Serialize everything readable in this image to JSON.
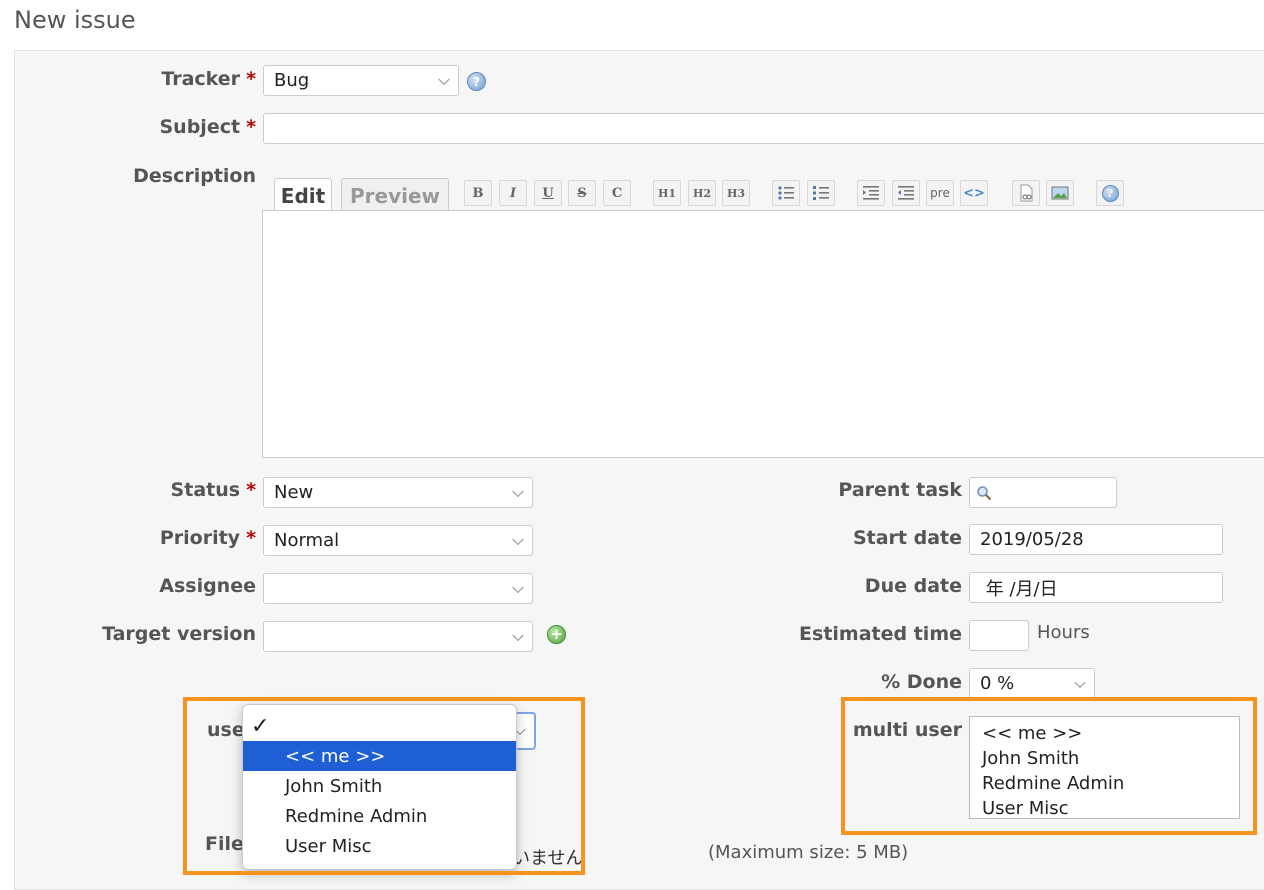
{
  "page": {
    "title": "New issue"
  },
  "tracker": {
    "label": "Tracker",
    "required_mark": "*",
    "value": "Bug"
  },
  "subject": {
    "label": "Subject",
    "required_mark": "*",
    "value": ""
  },
  "description": {
    "label": "Description",
    "tabs": [
      {
        "label": "Edit"
      },
      {
        "label": "Preview"
      }
    ],
    "toolbar": {
      "bold": "B",
      "italic": "I",
      "underline": "U",
      "strike": "S",
      "code": "C",
      "h1": "H1",
      "h2": "H2",
      "h3": "H3",
      "pre": "pre",
      "inline_code": "<>"
    }
  },
  "status": {
    "label": "Status",
    "required_mark": "*",
    "value": "New"
  },
  "priority": {
    "label": "Priority",
    "required_mark": "*",
    "value": "Normal"
  },
  "assignee": {
    "label": "Assignee",
    "value": ""
  },
  "target_version": {
    "label": "Target version",
    "value": ""
  },
  "parent_task": {
    "label": "Parent task",
    "value": ""
  },
  "start_date": {
    "label": "Start date",
    "value": "2019/05/28"
  },
  "due_date": {
    "label": "Due date",
    "value": " 年 /月/日"
  },
  "estimated_time": {
    "label": "Estimated time",
    "value": "",
    "unit": "Hours"
  },
  "done": {
    "label": "% Done",
    "value": "0 %"
  },
  "user_field": {
    "label_visible": "use",
    "check_mark": "✓",
    "options": [
      "<< me >>",
      "John Smith",
      "Redmine Admin",
      "User Misc"
    ]
  },
  "multi_user": {
    "label": "multi user",
    "options": [
      "<< me >>",
      "John Smith",
      "Redmine Admin",
      "User Misc"
    ]
  },
  "files": {
    "label_visible": "File",
    "no_file_text_visible": "いません",
    "max_size": "(Maximum size: 5 MB)"
  },
  "colors": {
    "highlight": "#f7931e",
    "selected_option": "#1f5fd6",
    "required": "#bb0000"
  }
}
